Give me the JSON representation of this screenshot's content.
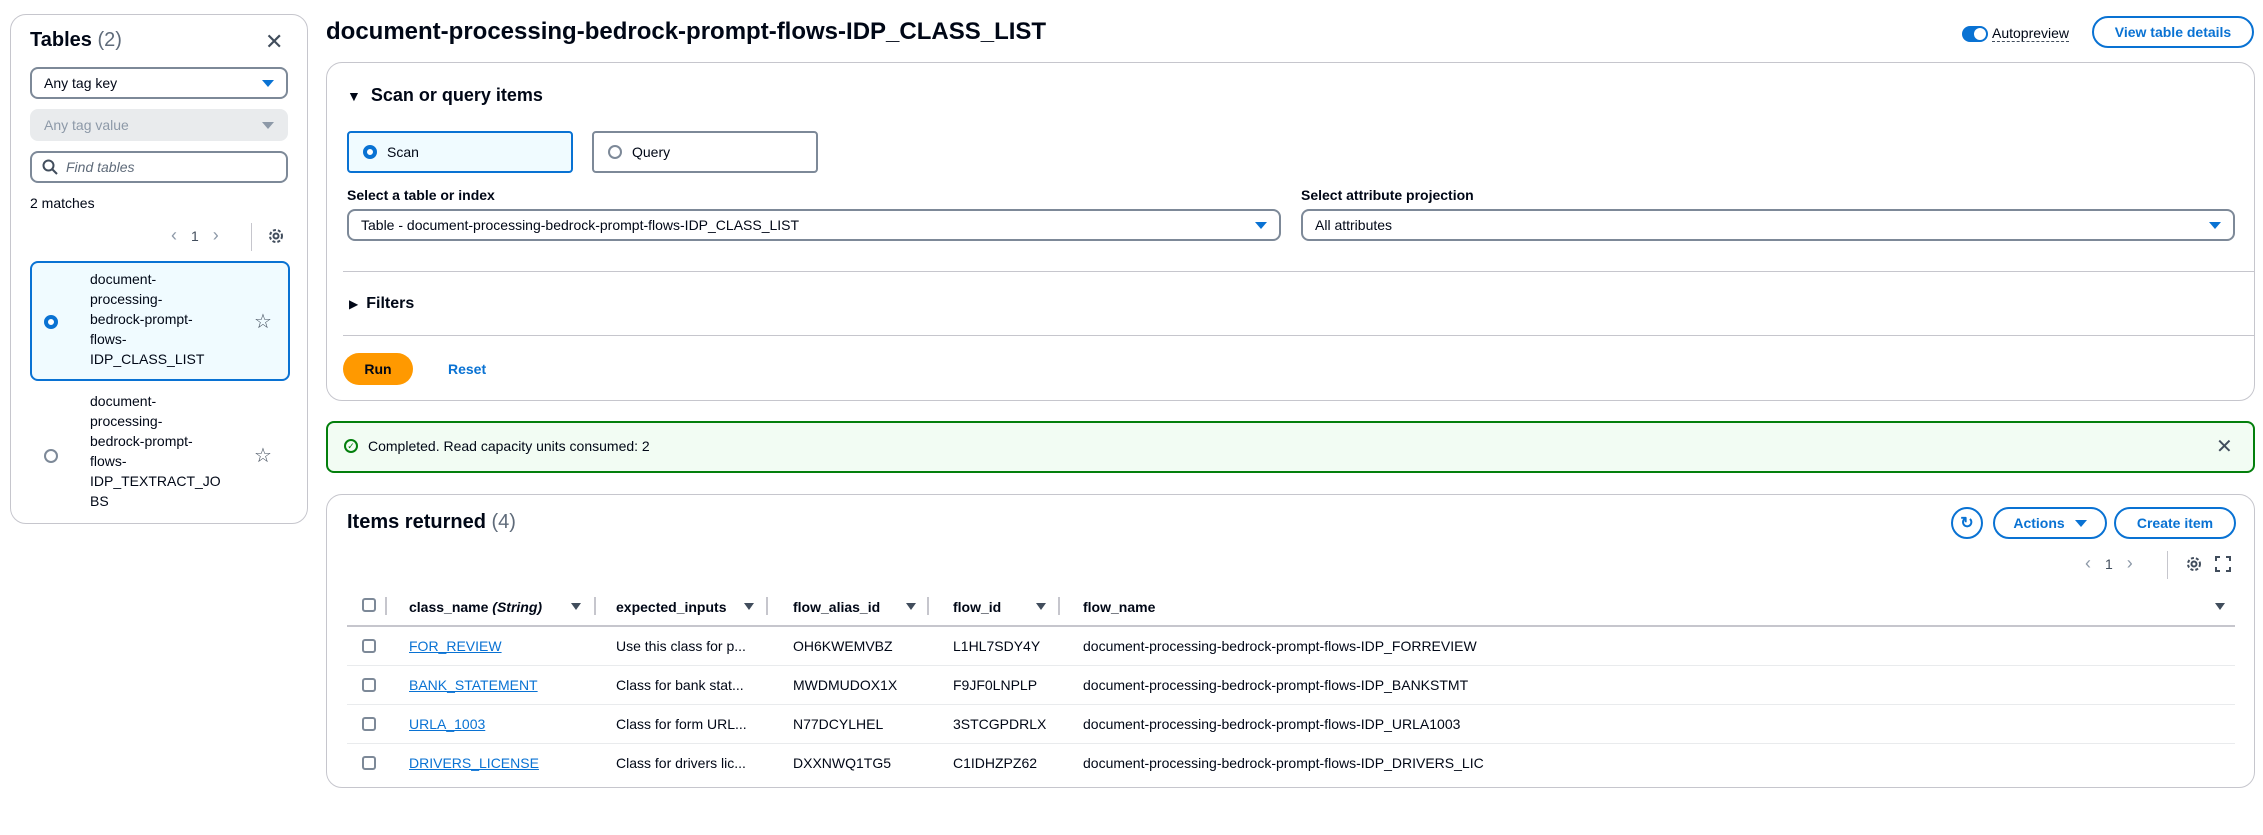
{
  "sidebar": {
    "title": "Tables",
    "count": "(2)",
    "tag_key": "Any tag key",
    "tag_value": "Any tag value",
    "search_placeholder": "Find tables",
    "matches": "2 matches",
    "page": "1",
    "tables": [
      {
        "name": "document-\nprocessing-\nbedrock-prompt-\nflows-\nIDP_CLASS_LIST",
        "selected": true
      },
      {
        "name": "document-\nprocessing-\nbedrock-prompt-\nflows-\nIDP_TEXTRACT_JO\nBS",
        "selected": false
      }
    ]
  },
  "header": {
    "title": "document-processing-bedrock-prompt-flows-IDP_CLASS_LIST",
    "autopreview_label": "Autopreview",
    "view_details_label": "View table details"
  },
  "scan": {
    "section_title": "Scan or query items",
    "scan_label": "Scan",
    "query_label": "Query",
    "table_select_label": "Select a table or index",
    "table_select_value": "Table - document-processing-bedrock-prompt-flows-IDP_CLASS_LIST",
    "projection_label": "Select attribute projection",
    "projection_value": "All attributes",
    "filters_label": "Filters",
    "run_label": "Run",
    "reset_label": "Reset"
  },
  "flash": {
    "message": "Completed. Read capacity units consumed: 2"
  },
  "items": {
    "title": "Items returned",
    "count": "(4)",
    "actions_label": "Actions",
    "create_label": "Create item",
    "page": "1",
    "columns": [
      "class_name",
      "(String)",
      "expected_inputs",
      "flow_alias_id",
      "flow_id",
      "flow_name"
    ],
    "rows": [
      [
        "FOR_REVIEW",
        "Use this class for p...",
        "OH6KWEMVBZ",
        "L1HL7SDY4Y",
        "document-processing-bedrock-prompt-flows-IDP_FORREVIEW"
      ],
      [
        "BANK_STATEMENT",
        "Class for bank stat...",
        "MWDMUDOX1X",
        "F9JF0LNPLP",
        "document-processing-bedrock-prompt-flows-IDP_BANKSTMT"
      ],
      [
        "URLA_1003",
        "Class for form URL...",
        "N77DCYLHEL",
        "3STCGPDRLX",
        "document-processing-bedrock-prompt-flows-IDP_URLA1003"
      ],
      [
        "DRIVERS_LICENSE",
        "Class for drivers lic...",
        "DXXNWQ1TG5",
        "C1IDHZPZ62",
        "document-processing-bedrock-prompt-flows-IDP_DRIVERS_LIC"
      ]
    ]
  }
}
